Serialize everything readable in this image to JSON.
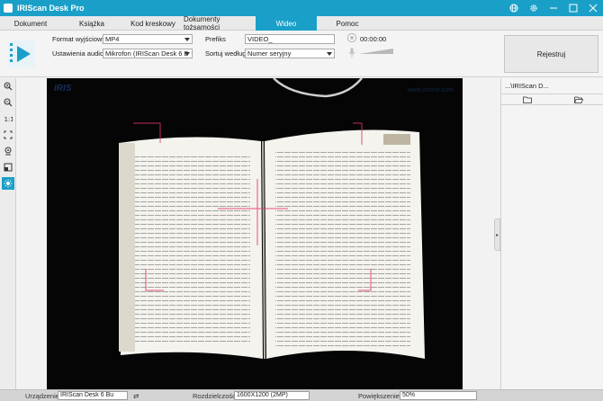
{
  "window": {
    "title": "IRIScan Desk Pro"
  },
  "tabs": [
    {
      "label": "Dokument"
    },
    {
      "label": "Książka"
    },
    {
      "label": "Kod kreskowy"
    },
    {
      "label": "Dokumenty tożsamości"
    },
    {
      "label": "Wideo",
      "active": true
    },
    {
      "label": "Pomoc"
    }
  ],
  "toolbar": {
    "output_format_label": "Format wyjściowy",
    "output_format_value": "MP4",
    "audio_settings_label": "Ustawienia audio",
    "audio_settings_value": "Mikrofon (IRIScan Desk 6 B",
    "prefix_label": "Prefiks",
    "prefix_value": "VIDEO_",
    "sort_label": "Sortuj według",
    "sort_value": "Numer seryjny",
    "timer": "00:00:00",
    "register_label": "Rejestruj"
  },
  "preview": {
    "watermark": "IRIS",
    "watermark_right": "www.irislink.com"
  },
  "right_panel": {
    "title": "...\\IRIScan D..."
  },
  "status_bar": {
    "device_label": "Urządzenie",
    "device_value": "IRIScan Desk 6 Bu",
    "resolution_label": "Rozdzielczość",
    "resolution_value": "1600X1200 (2MP)",
    "zoom_label": "Powiększenie",
    "zoom_value": "50%"
  },
  "colors": {
    "accent": "#1aa0c8",
    "preview_bg": "#050505"
  }
}
